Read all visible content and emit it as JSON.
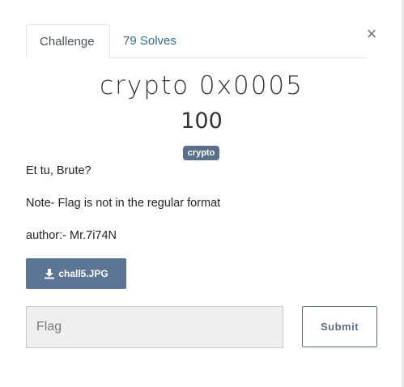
{
  "tabs": {
    "challenge_label": "Challenge",
    "solves_label": "79 Solves"
  },
  "close_icon": "×",
  "challenge": {
    "name": "crypto 0x0005",
    "points": "100",
    "tag": "crypto",
    "description": [
      "Et tu, Brute?",
      "Note- Flag is not in the regular format",
      "author:- Mr.7i74N"
    ],
    "file_label": "chall5.JPG",
    "file_icon": "download-icon"
  },
  "flag_form": {
    "placeholder": "Flag",
    "value": "",
    "submit_label": "Submit"
  },
  "colors": {
    "accent": "#5c6f8a",
    "link": "#2c6e9c",
    "file_button": "#5c7595"
  }
}
